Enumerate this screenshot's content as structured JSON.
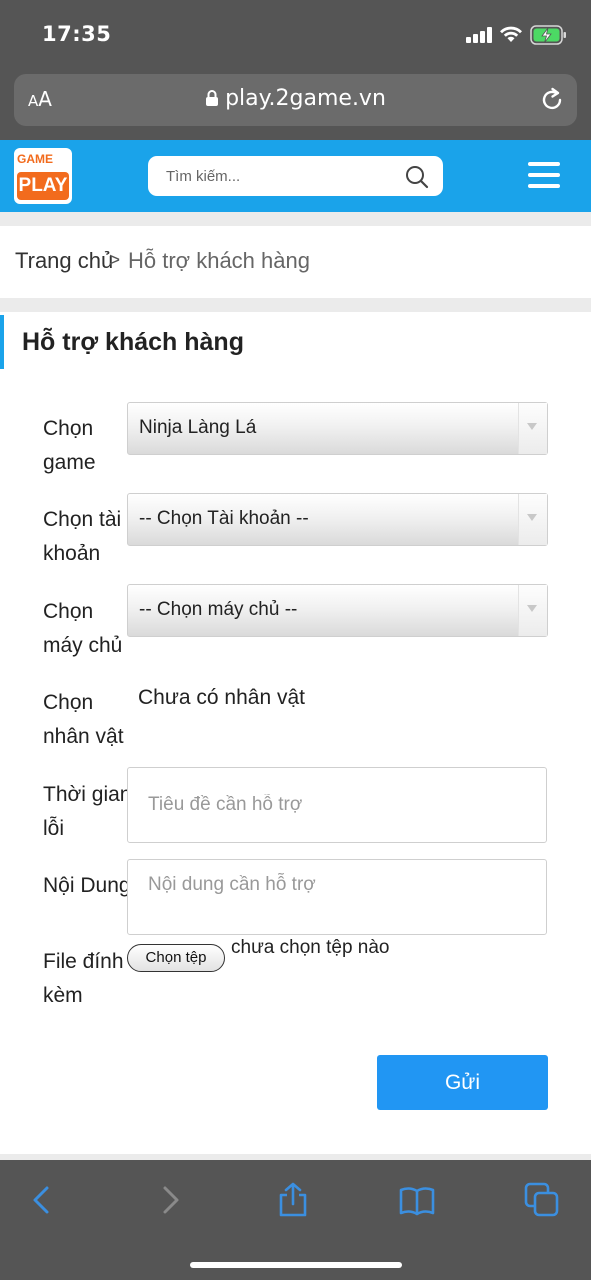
{
  "status_bar": {
    "time": "17:35"
  },
  "browser": {
    "text_size_label": "AA",
    "url": "play.2game.vn"
  },
  "header": {
    "logo_top": "GAME",
    "logo_bottom": "PLAY",
    "search_placeholder": "Tìm kiếm..."
  },
  "breadcrumb": {
    "home": "Trang chủ",
    "separator": ">",
    "current": "Hỗ trợ khách hàng"
  },
  "form": {
    "title": "Hỗ trợ khách hàng",
    "game_label_1": "Chọn",
    "game_label_2": "game",
    "game_value": "Ninja Làng Lá",
    "account_label_1": "Chọn tài",
    "account_label_2": "khoản",
    "account_value": "-- Chọn Tài khoản --",
    "server_label_1": "Chọn",
    "server_label_2": "máy chủ",
    "server_value": "-- Chọn máy chủ --",
    "character_label_1": "Chọn",
    "character_label_2": "nhân vật",
    "character_value": "Chưa có nhân vật",
    "time_label_1": "Thời gian",
    "time_label_2": "lỗi",
    "time_placeholder": "Tiêu đề cần hỗ trợ",
    "content_label": "Nội Dung",
    "content_placeholder": "Nội dung cần hỗ trợ",
    "file_label_1": "File đính",
    "file_label_2": "kèm",
    "file_button": "Chọn tệp",
    "file_status": "chưa chọn tệp nào",
    "submit": "Gửi"
  },
  "colors": {
    "header_blue": "#1aa3ea",
    "submit_blue": "#2196f3",
    "logo_orange": "#f26b1d",
    "toolbar_icon_blue": "#3b8fe0"
  }
}
